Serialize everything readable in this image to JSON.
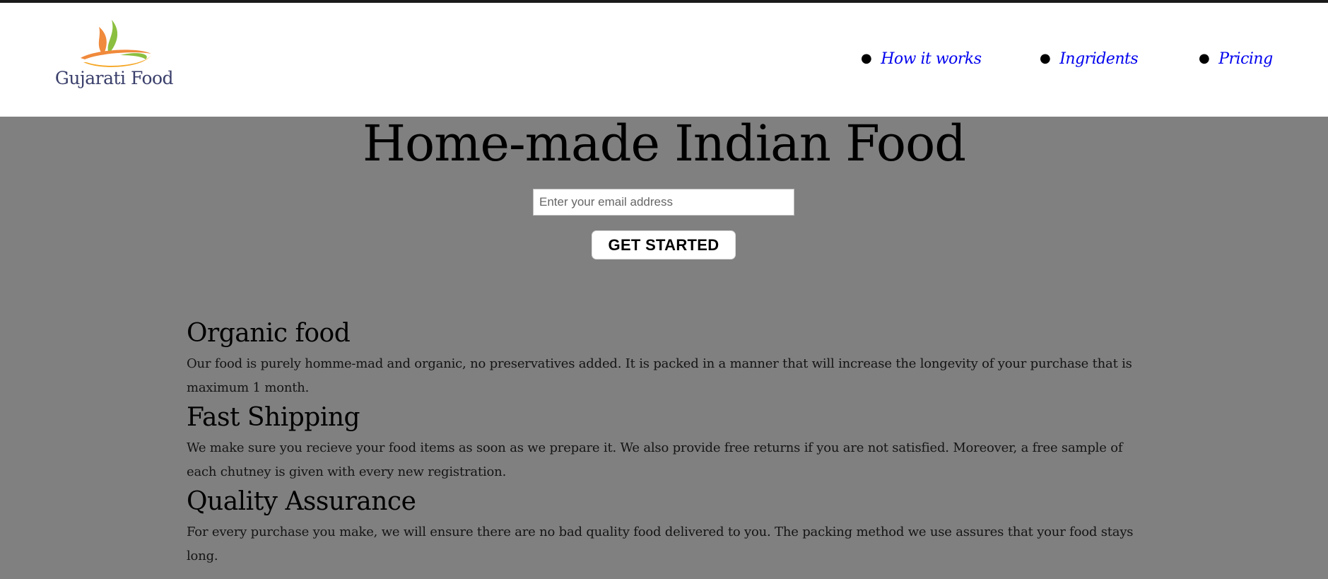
{
  "header": {
    "logo_text": "Gujarati Food",
    "logo_icon": "steaming-bowl-logo",
    "nav": [
      {
        "label": "How it works"
      },
      {
        "label": "Ingridents"
      },
      {
        "label": "Pricing"
      }
    ]
  },
  "hero": {
    "title": "Home-made Indian Food",
    "email_placeholder": "Enter your email address",
    "cta_label": "GET STARTED"
  },
  "features": [
    {
      "title": "Organic food",
      "text": "Our food is purely homme-mad and organic, no preservatives added. It is packed in a manner that will increase the longevity of your purchase that is maximum 1 month."
    },
    {
      "title": "Fast Shipping",
      "text": "We make sure you recieve your food items as soon as we prepare it. We also provide free returns if you are not satisfied. Moreover, a free sample of each chutney is given with every new registration."
    },
    {
      "title": "Quality Assurance",
      "text": "For every purchase you make, we will ensure there are no bad quality food delivered to you. The packing method we use assures that your food stays long."
    }
  ],
  "colors": {
    "background": "#808080",
    "header_bg": "#ffffff",
    "link": "#0000ee",
    "logo_text": "#3a3f6b",
    "flame_orange": "#f08a3c",
    "flame_green": "#8bbf3f"
  }
}
